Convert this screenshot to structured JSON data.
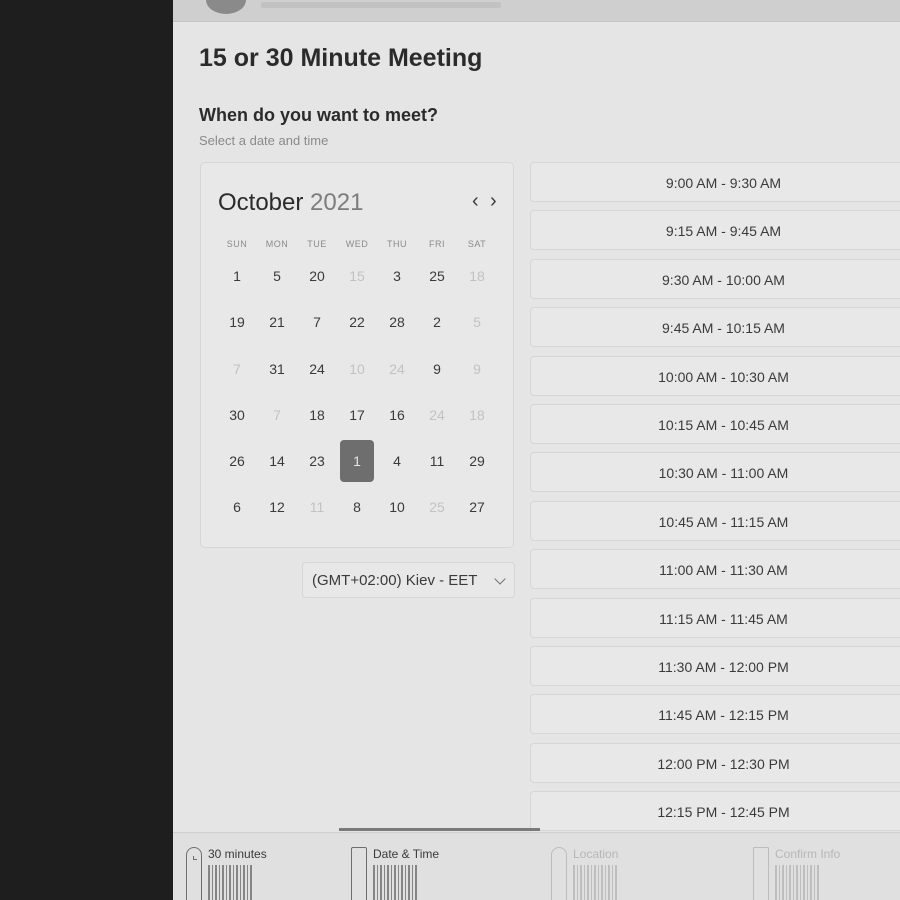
{
  "meeting": {
    "title": "15 or 30 Minute Meeting",
    "question": "When do you want to meet?",
    "subtitle": "Select a date and time"
  },
  "calendar": {
    "month": "October",
    "year": "2021",
    "prev_label": "‹",
    "next_label": "›",
    "weekdays": [
      "SUN",
      "MON",
      "TUE",
      "WED",
      "THU",
      "FRI",
      "SAT"
    ],
    "weeks": [
      [
        {
          "d": "1",
          "muted": false
        },
        {
          "d": "5",
          "muted": false
        },
        {
          "d": "20",
          "muted": false
        },
        {
          "d": "15",
          "muted": true
        },
        {
          "d": "3",
          "muted": false
        },
        {
          "d": "25",
          "muted": false
        },
        {
          "d": "18",
          "muted": true
        }
      ],
      [
        {
          "d": "19",
          "muted": false
        },
        {
          "d": "21",
          "muted": false
        },
        {
          "d": "7",
          "muted": false
        },
        {
          "d": "22",
          "muted": false
        },
        {
          "d": "28",
          "muted": false
        },
        {
          "d": "2",
          "muted": false
        },
        {
          "d": "5",
          "muted": true
        }
      ],
      [
        {
          "d": "7",
          "muted": true
        },
        {
          "d": "31",
          "muted": false
        },
        {
          "d": "24",
          "muted": false
        },
        {
          "d": "10",
          "muted": true
        },
        {
          "d": "24",
          "muted": true
        },
        {
          "d": "9",
          "muted": false
        },
        {
          "d": "9",
          "muted": true
        }
      ],
      [
        {
          "d": "30",
          "muted": false
        },
        {
          "d": "7",
          "muted": true
        },
        {
          "d": "18",
          "muted": false
        },
        {
          "d": "17",
          "muted": false
        },
        {
          "d": "16",
          "muted": false
        },
        {
          "d": "24",
          "muted": true
        },
        {
          "d": "18",
          "muted": true
        }
      ],
      [
        {
          "d": "26",
          "muted": false
        },
        {
          "d": "14",
          "muted": false
        },
        {
          "d": "23",
          "muted": false
        },
        {
          "d": "1",
          "muted": false,
          "selected": true
        },
        {
          "d": "4",
          "muted": false
        },
        {
          "d": "11",
          "muted": false
        },
        {
          "d": "29",
          "muted": false
        }
      ],
      [
        {
          "d": "6",
          "muted": false
        },
        {
          "d": "12",
          "muted": false
        },
        {
          "d": "11",
          "muted": true
        },
        {
          "d": "8",
          "muted": false
        },
        {
          "d": "10",
          "muted": false
        },
        {
          "d": "25",
          "muted": true
        },
        {
          "d": "27",
          "muted": false
        }
      ]
    ]
  },
  "timezone": {
    "selected": "(GMT+02:00) Kiev - EET"
  },
  "time_slots": [
    "9:00 AM - 9:30 AM",
    "9:15 AM - 9:45 AM",
    "9:30 AM - 10:00 AM",
    "9:45 AM - 10:15 AM",
    "10:00 AM - 10:30 AM",
    "10:15 AM - 10:45 AM",
    "10:30 AM - 11:00 AM",
    "10:45 AM - 11:15 AM",
    "11:00 AM - 11:30 AM",
    "11:15 AM - 11:45 AM",
    "11:30 AM - 12:00 PM",
    "11:45 AM - 12:15 PM",
    "12:00 PM - 12:30 PM",
    "12:15 PM - 12:45 PM"
  ],
  "steps": [
    {
      "label": "30 minutes",
      "icon": "clock-icon",
      "state": "done"
    },
    {
      "label": "Date & Time",
      "icon": "calendar-icon",
      "state": "active"
    },
    {
      "label": "Location",
      "icon": "location-pin-icon",
      "state": "upcoming"
    },
    {
      "label": "Confirm Info",
      "icon": "document-icon",
      "state": "upcoming"
    }
  ],
  "colors": {
    "background": "#1e1e1e",
    "panel": "#e5e5e5",
    "selected_day": "#6e6e6e",
    "text": "#2b2b2b"
  }
}
